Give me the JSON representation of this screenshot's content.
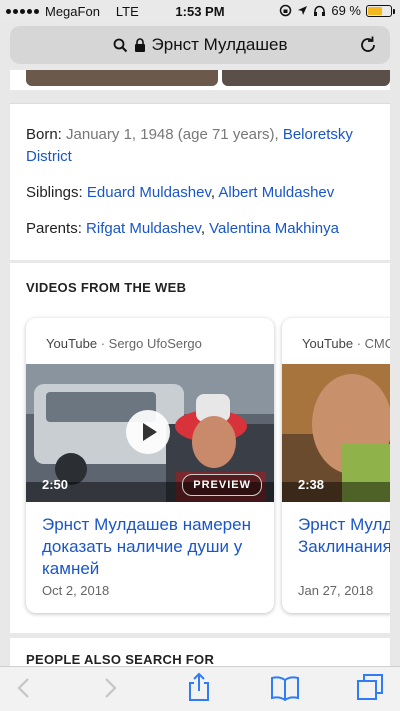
{
  "status": {
    "carrier": "MegaFon",
    "network": "LTE",
    "time": "1:53 PM",
    "battery": "69 %",
    "battery_level": 0.69
  },
  "address": {
    "query": "Эрнст Мулдашев"
  },
  "info": {
    "born_label": "Born: ",
    "born_value": "January 1, 1948 (age 71 years), ",
    "born_place_1": "Beloretsky",
    "born_place_2": "District",
    "siblings_label": "Siblings: ",
    "sibling_1": "Eduard Muldashev",
    "sibling_sep": ", ",
    "sibling_2": "Albert Muldashev",
    "parents_label": "Parents: ",
    "parent_1": "Rifgat Muldashev",
    "parent_sep": ", ",
    "parent_2": "Valentina Makhinya"
  },
  "videos": {
    "heading": "VIDEOS FROM THE WEB",
    "items": [
      {
        "source": "YouTube",
        "sep": " · ",
        "channel": "Sergo UfoSergo",
        "duration": "2:50",
        "preview": "PREVIEW",
        "title": "Эрнст Мулдашев намерен доказать наличие души у камней",
        "date": "Oct 2, 2018"
      },
      {
        "source": "YouTube",
        "sep": " · ",
        "channel": "СМОТ",
        "duration": "2:38",
        "title": "Эрнст Мулда (интервью)ча Заклинания",
        "date": "Jan 27, 2018"
      }
    ]
  },
  "people": {
    "heading": "PEOPLE ALSO SEARCH FOR"
  },
  "colors": {
    "link": "#1a56c8",
    "accent": "#2f7cf6",
    "battery": "#f2b81e"
  },
  "icons": [
    "signal-icon",
    "location-icon",
    "headphones-icon",
    "lock-icon",
    "search-icon",
    "reload-icon",
    "back-icon",
    "forward-icon",
    "share-icon",
    "bookmarks-icon",
    "tabs-icon"
  ]
}
